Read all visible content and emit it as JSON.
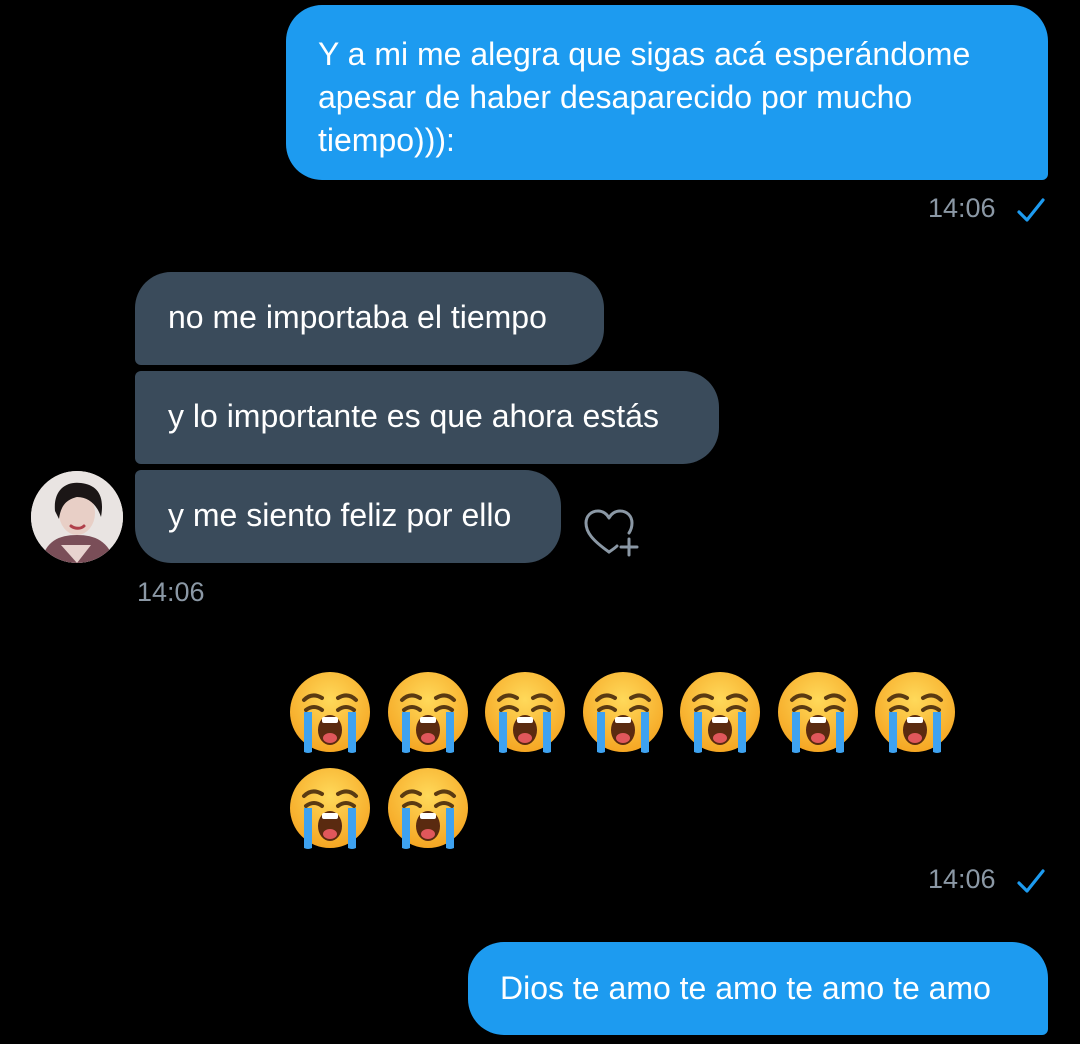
{
  "conversation": {
    "messages": [
      {
        "direction": "outgoing",
        "lines": [
          "Y a mi me alegra que sigas acá esperándome",
          "apesar de haber desaparecido por mucho",
          "tiempo))):"
        ],
        "time": "14:06",
        "status": "sent-check-icon"
      },
      {
        "direction": "incoming",
        "group": [
          "no me importaba el tiempo",
          "y lo importante es que ahora estás",
          "y me siento feliz por ello"
        ],
        "time": "14:06",
        "reaction_icon": "heart-plus-icon",
        "avatar_icon": "profile-avatar"
      },
      {
        "direction": "outgoing",
        "emoji": "😭😭😭😭😭😭😭😭😭",
        "emoji_icon": "loudly-crying-face-emoji",
        "emoji_count": 9,
        "time": "14:06",
        "status": "sent-check-icon"
      },
      {
        "direction": "outgoing",
        "text": "Dios te amo te amo te amo te amo"
      }
    ]
  },
  "colors": {
    "background": "#000000",
    "outgoing_bubble": "#1d9bf0",
    "incoming_bubble": "#3a4b5b",
    "timestamp": "#8b98a5",
    "check": "#1d9bf0"
  }
}
